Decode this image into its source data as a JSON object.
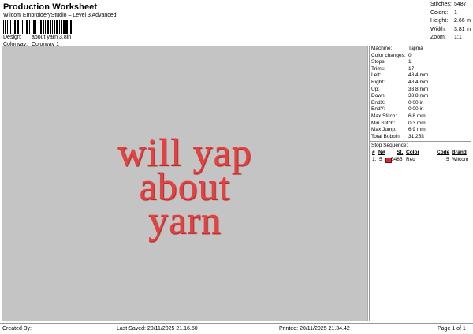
{
  "header": {
    "title": "Production Worksheet",
    "subtitle": "Wilcom EmbroideryStudio – Level 3 Advanced",
    "design_label": "Design:",
    "design_value": "about yarn 3,8in",
    "colorway_label": "Colorway:",
    "colorway_value": "Colorway 1"
  },
  "stats": [
    {
      "label": "Stitches:",
      "value": "5487"
    },
    {
      "label": "Colors:",
      "value": "1"
    },
    {
      "label": "Height:",
      "value": "2.66 in"
    },
    {
      "label": "Width:",
      "value": "3.81 in"
    },
    {
      "label": "Zoom:",
      "value": "1:1"
    }
  ],
  "design_text": [
    "will yap",
    "about",
    "yarn"
  ],
  "colors": {
    "thread": "#e6403f",
    "canvas": "#c4c4c4",
    "swatch": "#dd2b2b"
  },
  "machine": [
    {
      "label": "Machine:",
      "value": "Tajima"
    },
    {
      "label": "Color changes:",
      "value": "0"
    },
    {
      "label": "Stops:",
      "value": "1"
    },
    {
      "label": "Trims:",
      "value": "17"
    },
    {
      "label": "Left:",
      "value": "48.4 mm"
    },
    {
      "label": "Right:",
      "value": "48.4 mm"
    },
    {
      "label": "Up:",
      "value": "33.8 mm"
    },
    {
      "label": "Down:",
      "value": "33.8 mm"
    },
    {
      "label": "EndX:",
      "value": "0.00 in"
    },
    {
      "label": "EndY:",
      "value": "0.00 in"
    },
    {
      "label": "Max Stitch:",
      "value": "6.8 mm"
    },
    {
      "label": "Min Stitch:",
      "value": "0.3 mm"
    },
    {
      "label": "Max Jump:",
      "value": "6.9 mm"
    },
    {
      "label": "Total Bobbin:",
      "value": "31.25ft"
    }
  ],
  "stop_sequence": {
    "title": "Stop Sequence:",
    "headers": [
      "#",
      "N#",
      "St.",
      "Color",
      "Code",
      "Brand"
    ],
    "rows": [
      {
        "index": "1.",
        "n": "5",
        "stitches": "5485",
        "color": "Red",
        "code": "5",
        "brand": "Wilcom"
      }
    ]
  },
  "footer": {
    "created_by": "Created By:",
    "last_saved": "Last Saved: 20/11/2025 21.16.50",
    "printed": "Printed: 20/11/2025 21.34.42",
    "page": "Page 1 of 1"
  }
}
